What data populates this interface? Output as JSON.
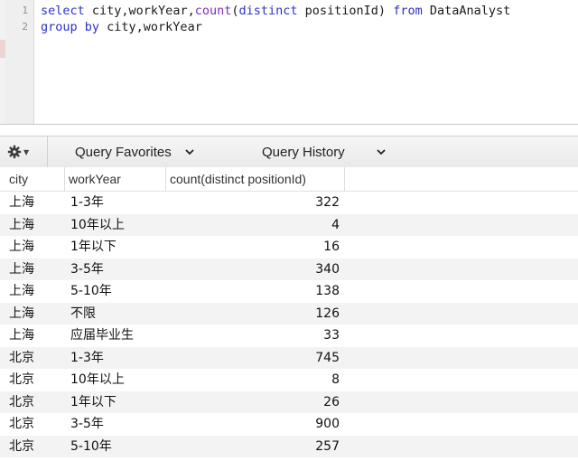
{
  "editor": {
    "lines": [
      {
        "number": "1",
        "tokens": [
          {
            "text": "select",
            "type": "kw"
          },
          {
            "text": " city,workYear,",
            "type": "plain"
          },
          {
            "text": "count",
            "type": "fn"
          },
          {
            "text": "(",
            "type": "plain"
          },
          {
            "text": "distinct",
            "type": "kw"
          },
          {
            "text": " positionId) ",
            "type": "plain"
          },
          {
            "text": "from",
            "type": "kw"
          },
          {
            "text": " DataAnalyst",
            "type": "plain"
          }
        ]
      },
      {
        "number": "2",
        "tokens": [
          {
            "text": "group by",
            "type": "kw"
          },
          {
            "text": " city,workYear",
            "type": "plain"
          }
        ]
      }
    ]
  },
  "toolbar": {
    "gear_icon": "gear-icon",
    "query_favorites": "Query Favorites",
    "query_history": "Query History"
  },
  "results": {
    "columns": [
      "city",
      "workYear",
      "count(distinct positionId)"
    ],
    "rows": [
      [
        "上海",
        "1-3年",
        "322"
      ],
      [
        "上海",
        "10年以上",
        "4"
      ],
      [
        "上海",
        "1年以下",
        "16"
      ],
      [
        "上海",
        "3-5年",
        "340"
      ],
      [
        "上海",
        "5-10年",
        "138"
      ],
      [
        "上海",
        "不限",
        "126"
      ],
      [
        "上海",
        "应届毕业生",
        "33"
      ],
      [
        "北京",
        "1-3年",
        "745"
      ],
      [
        "北京",
        "10年以上",
        "8"
      ],
      [
        "北京",
        "1年以下",
        "26"
      ],
      [
        "北京",
        "3-5年",
        "900"
      ],
      [
        "北京",
        "5-10年",
        "257"
      ]
    ]
  },
  "colors": {
    "keyword": "#2b30c9",
    "function": "#7a2bbf",
    "alt_row": "#f3f3f3"
  }
}
